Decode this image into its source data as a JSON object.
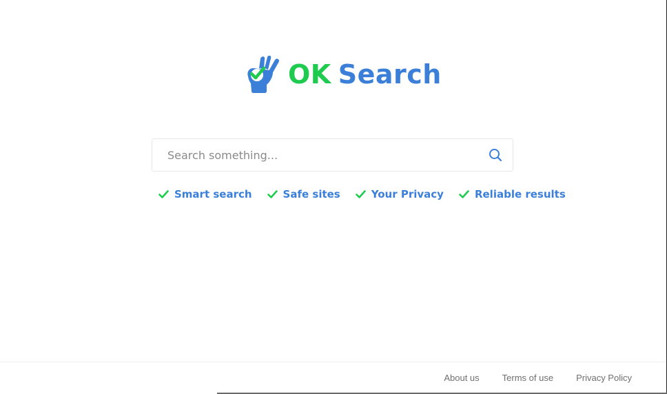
{
  "brand": {
    "name_part1": "OK",
    "name_part2": "Search",
    "logo_icon": "ok-hand-check-icon",
    "color_green": "#1ecb4f",
    "color_blue": "#3b7fd9"
  },
  "search": {
    "placeholder": "Search something...",
    "value": "",
    "button_icon": "search-icon"
  },
  "features": [
    {
      "icon": "check-icon",
      "label": "Smart search"
    },
    {
      "icon": "check-icon",
      "label": "Safe sites"
    },
    {
      "icon": "check-icon",
      "label": "Your Privacy"
    },
    {
      "icon": "check-icon",
      "label": "Reliable results"
    }
  ],
  "footer": {
    "links": [
      {
        "label": "About us"
      },
      {
        "label": "Terms of use"
      },
      {
        "label": "Privacy Policy"
      }
    ]
  }
}
